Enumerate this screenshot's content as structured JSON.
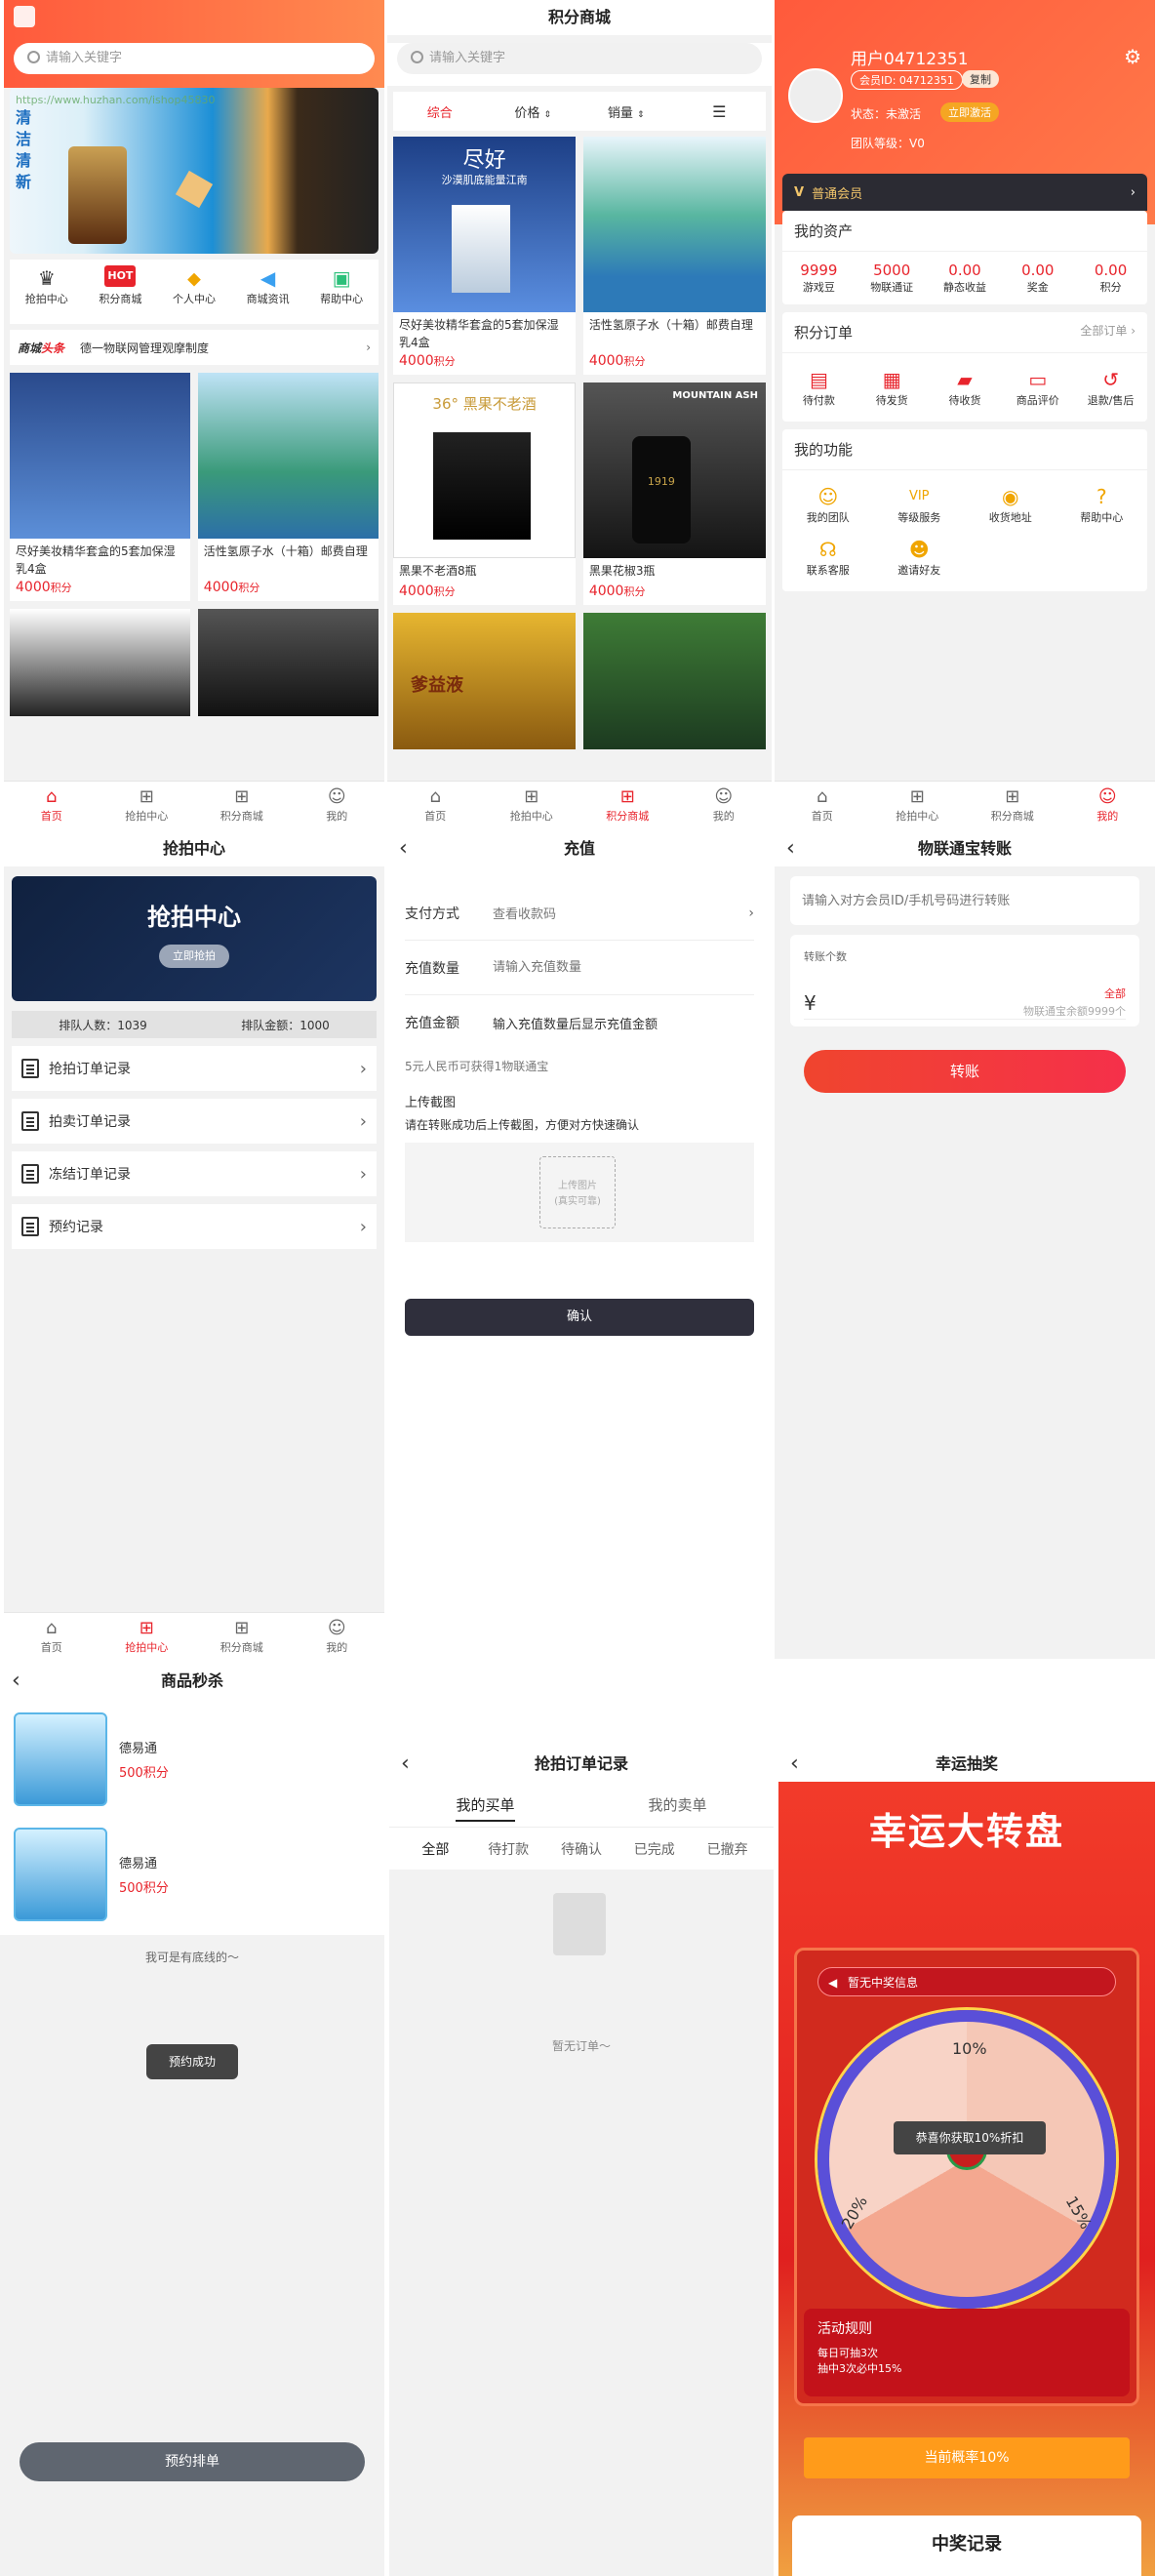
{
  "home": {
    "search_placeholder": "请输入关键字",
    "watermark": "https://www.huzhan.com/ishop45830",
    "banner_text": "清洁清新",
    "categories": [
      {
        "icon": "crown-icon",
        "glyph": "♛",
        "label": "抢拍中心"
      },
      {
        "icon": "hot-tag-icon",
        "glyph": "HOT",
        "label": "积分商城"
      },
      {
        "icon": "chevron-badge-icon",
        "glyph": "⌄",
        "label": "个人中心"
      },
      {
        "icon": "megaphone-icon",
        "glyph": "📢",
        "label": "商城资讯"
      },
      {
        "icon": "chat-icon",
        "glyph": "▣",
        "label": "帮助中心"
      }
    ],
    "news_brand_a": "商城",
    "news_brand_b": "头条",
    "news_text": "德一物联网管理观摩制度",
    "products": [
      {
        "name": "尽好美妆精华套盒的5套加保湿乳4盒",
        "price": "4000",
        "unit": "积分"
      },
      {
        "name": "活性氢原子水（十箱）邮费自理",
        "price": "4000",
        "unit": "积分"
      }
    ]
  },
  "tabs": {
    "home": "首页",
    "grab": "抢拍中心",
    "mall": "积分商城",
    "me": "我的"
  },
  "mall": {
    "title": "积分商城",
    "search_placeholder": "请输入关键字",
    "filters": [
      "综合",
      "价格",
      "销量"
    ],
    "products": [
      {
        "name": "尽好美妆精华套盒的5套加保湿乳4盒",
        "price": "4000",
        "unit": "积分",
        "theme": "cosmetics"
      },
      {
        "name": "活性氢原子水（十箱）邮费自理",
        "price": "4000",
        "unit": "积分",
        "theme": "lake"
      },
      {
        "name": "黑果不老酒8瓶",
        "price": "4000",
        "unit": "积分",
        "theme": "liquor"
      },
      {
        "name": "黑果花椒3瓶",
        "price": "4000",
        "unit": "积分",
        "theme": "dark"
      }
    ],
    "product_text": {
      "cosmetics_brand": "尽好",
      "cosmetics_sub": "沙漠肌底能量江南",
      "liquor_banner": "36° 黑果不老酒",
      "mountain_banner": "MOUNTAIN ASH",
      "bottle_label": "1919",
      "yellow_label": "爹益液"
    }
  },
  "profile": {
    "username": "用户04712351",
    "member_id": "会员ID: 04712351",
    "copy_label": "复制",
    "status": "状态：未激活",
    "activate_label": "立即激活",
    "team_level": "团队等级：V0",
    "vip_label": "普通会员",
    "assets_title": "我的资产",
    "assets": [
      {
        "value": "9999",
        "label": "游戏豆"
      },
      {
        "value": "5000",
        "label": "物联通证"
      },
      {
        "value": "0.00",
        "label": "静态收益"
      },
      {
        "value": "0.00",
        "label": "奖金"
      },
      {
        "value": "0.00",
        "label": "积分"
      }
    ],
    "orders_title": "积分订单",
    "orders_all": "全部订单 ›",
    "orders": [
      {
        "icon": "wallet-icon",
        "label": "待付款"
      },
      {
        "icon": "box-icon",
        "label": "待发货"
      },
      {
        "icon": "truck-icon",
        "label": "待收货"
      },
      {
        "icon": "comment-icon",
        "label": "商品评价"
      },
      {
        "icon": "refund-icon",
        "label": "退款/售后"
      }
    ],
    "functions_title": "我的功能",
    "functions": [
      {
        "icon": "team-icon",
        "label": "我的团队"
      },
      {
        "icon": "vip-icon",
        "label": "等级服务"
      },
      {
        "icon": "location-icon",
        "label": "收货地址"
      },
      {
        "icon": "help-icon",
        "label": "帮助中心"
      },
      {
        "icon": "headset-icon",
        "label": "联系客服"
      },
      {
        "icon": "invite-icon",
        "label": "邀请好友"
      }
    ]
  },
  "grab": {
    "title": "抢拍中心",
    "banner_title": "抢拍中心",
    "banner_button": "立即抢拍",
    "queue_people": "排队人数：1039",
    "queue_amount": "排队金额：1000",
    "rows": [
      "抢拍订单记录",
      "拍卖订单记录",
      "冻结订单记录",
      "预约记录"
    ]
  },
  "recharge": {
    "title": "充值",
    "pay_label": "支付方式",
    "pay_value": "查看收款码",
    "qty_label": "充值数量",
    "qty_placeholder": "请输入充值数量",
    "amount_label": "充值金额",
    "amount_value": "输入充值数量后显示充值金额",
    "hint": "5元人民币可获得1物联通宝",
    "upload_label": "上传截图",
    "upload_hint": "请在转账成功后上传截图，方便对方快速确认",
    "upload_box_a": "上传图片",
    "upload_box_b": "(真实可靠)",
    "confirm": "确认"
  },
  "transfer": {
    "title": "物联通宝转账",
    "recipient_placeholder": "请输入对方会员ID/手机号码进行转账",
    "count_label": "转账个数",
    "all_label": "全部",
    "currency": "¥",
    "balance": "物联通宝余额9999个",
    "submit": "转账"
  },
  "seckill": {
    "title": "商品秒杀",
    "items": [
      {
        "name": "德易通",
        "price": "500",
        "unit": "积分"
      },
      {
        "name": "德易通",
        "price": "500",
        "unit": "积分"
      }
    ],
    "bottom_text": "我可是有底线的～",
    "toast": "预约成功",
    "reserve_button": "预约排单"
  },
  "grab_orders": {
    "title": "抢拍订单记录",
    "seg_buy": "我的买单",
    "seg_sell": "我的卖单",
    "status_tabs": [
      "全部",
      "待打款",
      "待确认",
      "已完成",
      "已撤弃"
    ],
    "empty": "暂无订单～"
  },
  "lottery": {
    "title": "幸运抽奖",
    "headline": "幸运大转盘",
    "notice": "暂无中奖信息",
    "slice_labels": [
      "10%",
      "15%",
      "20%"
    ],
    "center_toast": "恭喜你获取10%折扣",
    "rules_title": "活动规则",
    "rules": [
      "每日可抽3次",
      "抽中3次必中15%"
    ],
    "probability_button": "当前概率10%",
    "record_title": "中奖记录"
  },
  "colors": {
    "brand_red": "#e8242c",
    "orange": "#ff8a1e",
    "dark_button": "#2f2f3c"
  }
}
